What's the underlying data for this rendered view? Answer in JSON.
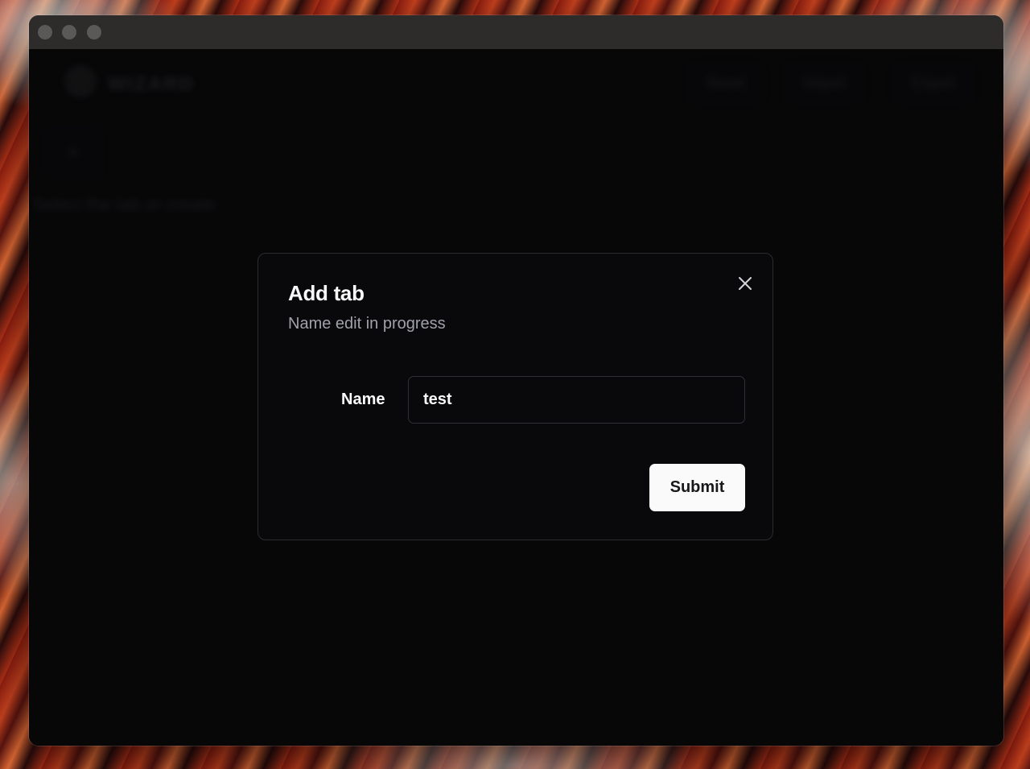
{
  "background_app": {
    "brand": "WIZARD",
    "nav": {
      "reset_label": "Reset",
      "import_label": "Import",
      "export_label": "Export"
    },
    "add_tab_symbol": "+",
    "hint": "Select the tab or create"
  },
  "dialog": {
    "title": "Add tab",
    "subtitle": "Name edit in progress",
    "close_icon": "close-icon",
    "name_label": "Name",
    "name_value": "test",
    "submit_label": "Submit"
  },
  "colors": {
    "dialog_bg": "#09090b",
    "primary_button_bg": "#fafafa",
    "primary_button_text": "#18181b",
    "muted_text": "#a1a1aa"
  }
}
